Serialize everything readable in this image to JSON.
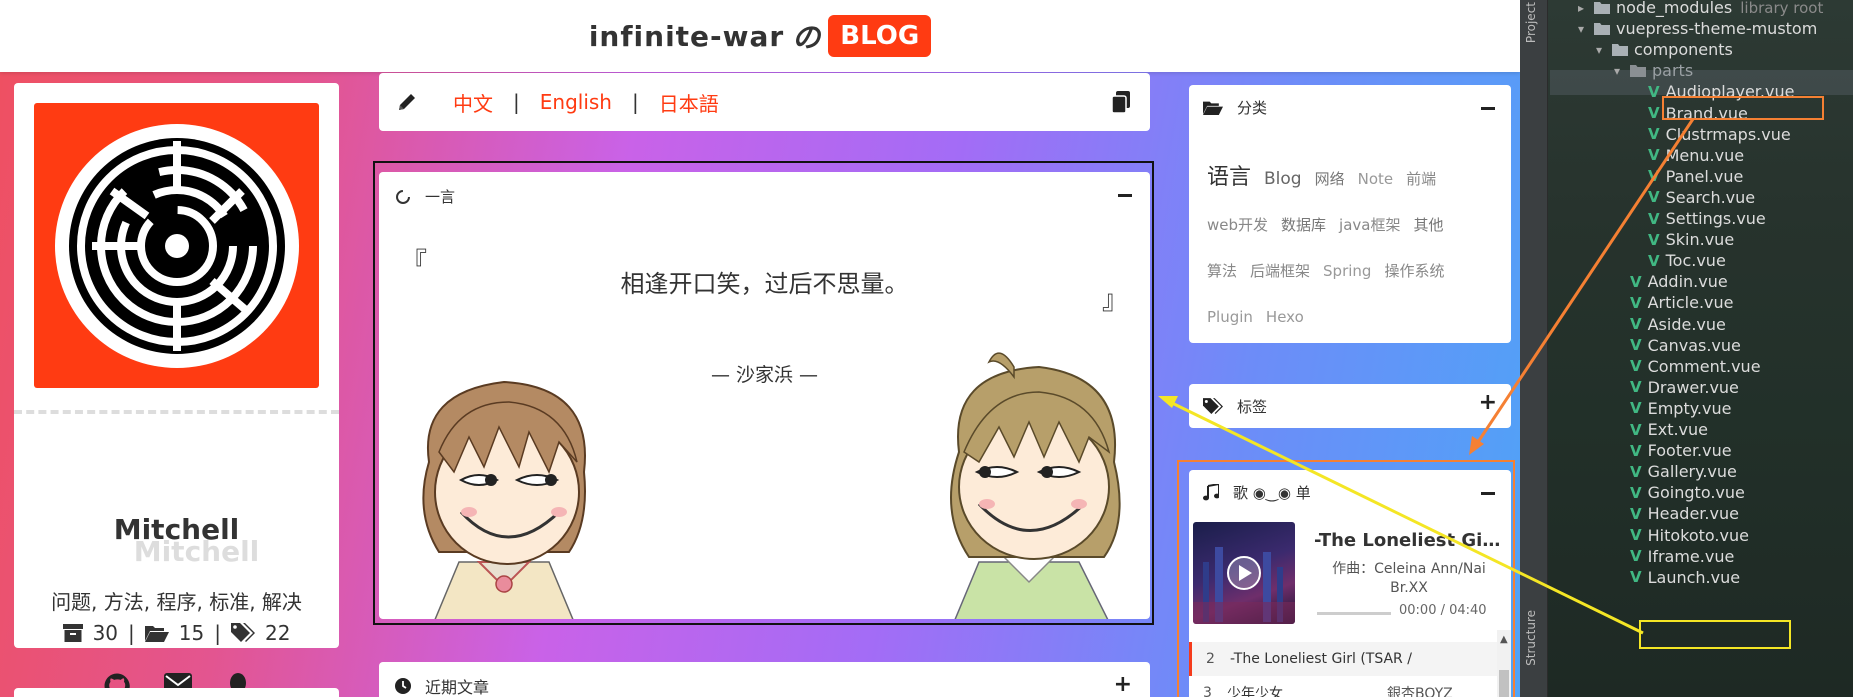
{
  "header": {
    "brand_name": "infinite-war",
    "brand_no": "の",
    "brand_badge": "BLOG"
  },
  "profile": {
    "name": "Mitchell",
    "motto": "问题, 方法, 程序, 标准, 解决",
    "stats": {
      "articles": "30",
      "categories": "15",
      "tags": "22",
      "sep": "|"
    },
    "socials": [
      "github-icon",
      "mail-icon",
      "qq-icon"
    ]
  },
  "langbar": {
    "langs": [
      "中文",
      "English",
      "日本語"
    ],
    "sep": "|"
  },
  "hitokoto": {
    "title": "一言",
    "quote_open": "『",
    "quote_close": "』",
    "quote": "相逢开口笑，过后不思量。",
    "from": "— 沙家浜 —"
  },
  "recent": {
    "title": "近期文章",
    "toggle": "+"
  },
  "categories": {
    "title": "分类",
    "items": [
      {
        "label": "语言",
        "size": 22,
        "color": "#333333"
      },
      {
        "label": "Blog",
        "size": 17,
        "color": "#666666"
      },
      {
        "label": "网络",
        "size": 15,
        "color": "#777777"
      },
      {
        "label": "Note",
        "size": 15,
        "color": "#999999"
      },
      {
        "label": "前端",
        "size": 15,
        "color": "#888888"
      },
      {
        "label": "web开发",
        "size": 15,
        "color": "#888888"
      },
      {
        "label": "数据库",
        "size": 15,
        "color": "#777777"
      },
      {
        "label": "java框架",
        "size": 15,
        "color": "#888888"
      },
      {
        "label": "其他",
        "size": 15,
        "color": "#777777"
      },
      {
        "label": "算法",
        "size": 15,
        "color": "#888888"
      },
      {
        "label": "后端框架",
        "size": 15,
        "color": "#888888"
      },
      {
        "label": "Spring",
        "size": 15,
        "color": "#999999"
      },
      {
        "label": "操作系统",
        "size": 15,
        "color": "#888888"
      },
      {
        "label": "Plugin",
        "size": 15,
        "color": "#999999"
      },
      {
        "label": "Hexo",
        "size": 15,
        "color": "#999999"
      }
    ]
  },
  "tags": {
    "title": "标签",
    "toggle": "+"
  },
  "music": {
    "title": "歌 ◉‿◉ 单",
    "now_title": "-The Loneliest Girl...",
    "artist": "作曲：Celeina Ann/Nai Br.XX",
    "time": "00:00 / 04:40",
    "progress": 0.0,
    "playlist": [
      {
        "idx": "2",
        "title": "-The Loneliest Girl (TSAR /",
        "artist": ""
      },
      {
        "idx": "3",
        "title": "少年少女",
        "artist": "銀杏BOYZ"
      }
    ]
  },
  "ide": {
    "side_labels": [
      "Project",
      "Structure"
    ],
    "tree": [
      {
        "label": "node_modules",
        "extra": "library root",
        "kind": "folder",
        "depth": 2,
        "arrow": "▸"
      },
      {
        "label": "vuepress-theme-mustom",
        "kind": "folder",
        "depth": 2,
        "arrow": "▾"
      },
      {
        "label": "components",
        "kind": "folder",
        "depth": 3,
        "arrow": "▾"
      },
      {
        "label": "parts",
        "kind": "folder-dim",
        "depth": 4,
        "arrow": "▾"
      },
      {
        "label": "Audioplayer.vue",
        "kind": "vue",
        "depth": 5
      },
      {
        "label": "Brand.vue",
        "kind": "vue",
        "depth": 5
      },
      {
        "label": "Clustrmaps.vue",
        "kind": "vue",
        "depth": 5
      },
      {
        "label": "Menu.vue",
        "kind": "vue",
        "depth": 5
      },
      {
        "label": "Panel.vue",
        "kind": "vue",
        "depth": 5
      },
      {
        "label": "Search.vue",
        "kind": "vue",
        "depth": 5
      },
      {
        "label": "Settings.vue",
        "kind": "vue",
        "depth": 5
      },
      {
        "label": "Skin.vue",
        "kind": "vue",
        "depth": 5
      },
      {
        "label": "Toc.vue",
        "kind": "vue",
        "depth": 5
      },
      {
        "label": "Addin.vue",
        "kind": "vue",
        "depth": 4
      },
      {
        "label": "Article.vue",
        "kind": "vue",
        "depth": 4
      },
      {
        "label": "Aside.vue",
        "kind": "vue",
        "depth": 4
      },
      {
        "label": "Canvas.vue",
        "kind": "vue",
        "depth": 4
      },
      {
        "label": "Comment.vue",
        "kind": "vue",
        "depth": 4
      },
      {
        "label": "Drawer.vue",
        "kind": "vue",
        "depth": 4
      },
      {
        "label": "Empty.vue",
        "kind": "vue",
        "depth": 4
      },
      {
        "label": "Ext.vue",
        "kind": "vue",
        "depth": 4
      },
      {
        "label": "Footer.vue",
        "kind": "vue",
        "depth": 4
      },
      {
        "label": "Gallery.vue",
        "kind": "vue",
        "depth": 4
      },
      {
        "label": "Goingto.vue",
        "kind": "vue",
        "depth": 4
      },
      {
        "label": "Header.vue",
        "kind": "vue",
        "depth": 4
      },
      {
        "label": "Hitokoto.vue",
        "kind": "vue",
        "depth": 4
      },
      {
        "label": "Iframe.vue",
        "kind": "vue",
        "depth": 4
      },
      {
        "label": "Launch.vue",
        "kind": "vue",
        "depth": 4
      }
    ]
  },
  "colors": {
    "accent": "#ff3b12",
    "annotation_orange": "#f58033",
    "annotation_yellow": "#f4e625",
    "vue_green": "#41b883"
  }
}
